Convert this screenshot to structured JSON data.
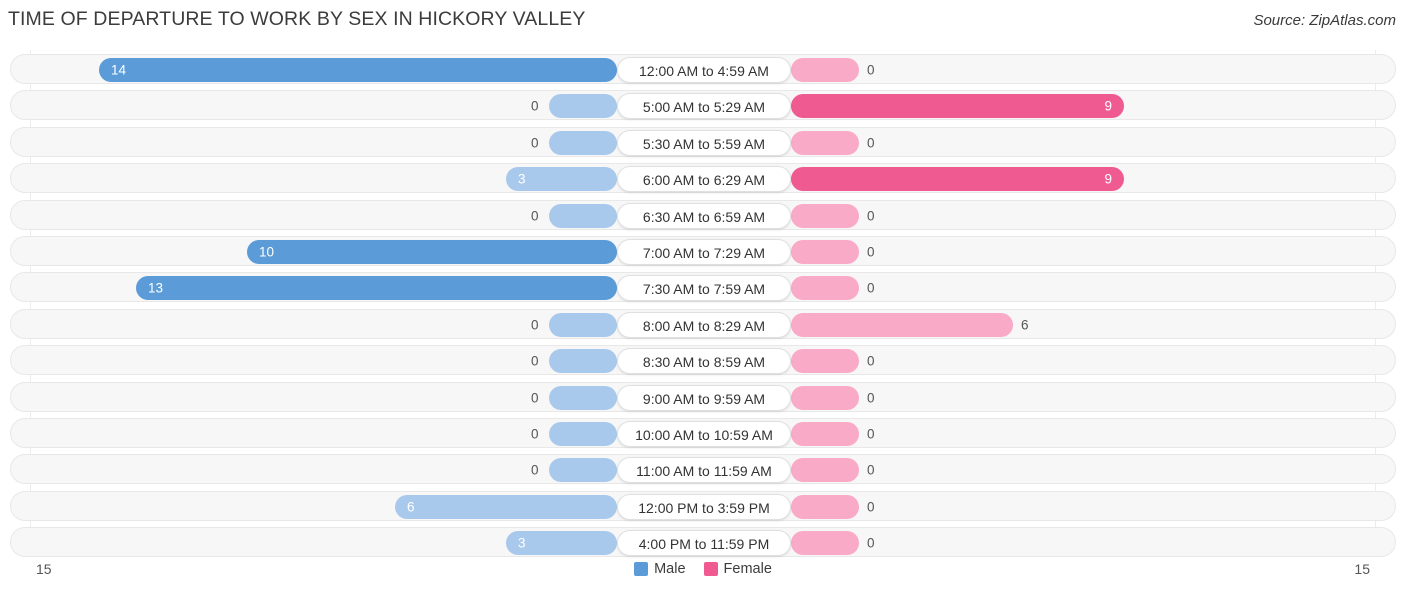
{
  "header": {
    "title": "TIME OF DEPARTURE TO WORK BY SEX IN HICKORY VALLEY",
    "source": "Source: ZipAtlas.com"
  },
  "axis": {
    "left_label": "15",
    "right_label": "15"
  },
  "legend": {
    "items": [
      {
        "label": "Male",
        "color": "#5a9bd8"
      },
      {
        "label": "Female",
        "color": "#ef5a91"
      }
    ]
  },
  "chart_data": {
    "type": "bar",
    "orientation": "horizontal-diverging",
    "title": "TIME OF DEPARTURE TO WORK BY SEX IN HICKORY VALLEY",
    "subtitle": "",
    "xlabel": "",
    "ylabel": "",
    "xlim": [
      15,
      15
    ],
    "grid": false,
    "legend_position": "bottom-center",
    "categories": [
      "12:00 AM to 4:59 AM",
      "5:00 AM to 5:29 AM",
      "5:30 AM to 5:59 AM",
      "6:00 AM to 6:29 AM",
      "6:30 AM to 6:59 AM",
      "7:00 AM to 7:29 AM",
      "7:30 AM to 7:59 AM",
      "8:00 AM to 8:29 AM",
      "8:30 AM to 8:59 AM",
      "9:00 AM to 9:59 AM",
      "10:00 AM to 10:59 AM",
      "11:00 AM to 11:59 AM",
      "12:00 PM to 3:59 PM",
      "4:00 PM to 11:59 PM"
    ],
    "series": [
      {
        "name": "Male",
        "color": "#5a9bd8",
        "values": [
          14,
          0,
          0,
          3,
          0,
          10,
          13,
          0,
          0,
          0,
          0,
          0,
          6,
          3
        ]
      },
      {
        "name": "Female",
        "color": "#ef5a91",
        "values": [
          0,
          9,
          0,
          9,
          0,
          0,
          0,
          6,
          0,
          0,
          0,
          0,
          0,
          0
        ]
      }
    ]
  },
  "rows": [
    {
      "label": "12:00 AM to 4:59 AM",
      "male": 14,
      "female": 0
    },
    {
      "label": "5:00 AM to 5:29 AM",
      "male": 0,
      "female": 9
    },
    {
      "label": "5:30 AM to 5:59 AM",
      "male": 0,
      "female": 0
    },
    {
      "label": "6:00 AM to 6:29 AM",
      "male": 3,
      "female": 9
    },
    {
      "label": "6:30 AM to 6:59 AM",
      "male": 0,
      "female": 0
    },
    {
      "label": "7:00 AM to 7:29 AM",
      "male": 10,
      "female": 0
    },
    {
      "label": "7:30 AM to 7:59 AM",
      "male": 13,
      "female": 0
    },
    {
      "label": "8:00 AM to 8:29 AM",
      "male": 0,
      "female": 6
    },
    {
      "label": "8:30 AM to 8:59 AM",
      "male": 0,
      "female": 0
    },
    {
      "label": "9:00 AM to 9:59 AM",
      "male": 0,
      "female": 0
    },
    {
      "label": "10:00 AM to 10:59 AM",
      "male": 0,
      "female": 0
    },
    {
      "label": "11:00 AM to 11:59 AM",
      "male": 0,
      "female": 0
    },
    {
      "label": "12:00 PM to 3:59 PM",
      "male": 6,
      "female": 0
    },
    {
      "label": "4:00 PM to 11:59 PM",
      "male": 3,
      "female": 0
    }
  ]
}
